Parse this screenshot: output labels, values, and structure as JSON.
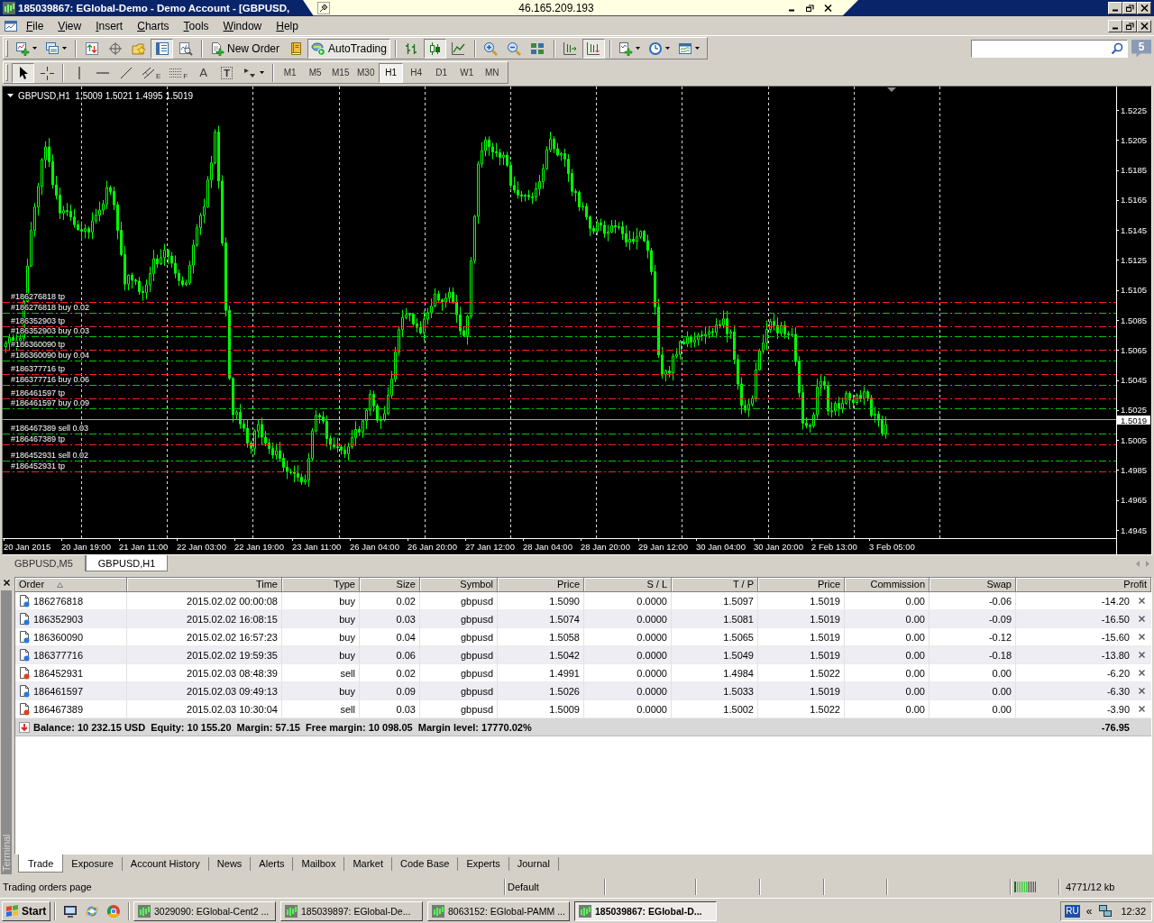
{
  "window": {
    "title": "185039867: EGlobal-Demo - Demo Account - [GBPUSD,"
  },
  "remote_bar": {
    "address": "46.165.209.193"
  },
  "menu": [
    "File",
    "View",
    "Insert",
    "Charts",
    "Tools",
    "Window",
    "Help"
  ],
  "toolbar": {
    "groups": [
      [
        {
          "kind": "new-chart",
          "pressed": false
        },
        {
          "kind": "profiles",
          "pressed": false
        }
      ],
      [
        {
          "kind": "market-watch",
          "pressed": false
        },
        {
          "kind": "data-window",
          "pressed": false
        },
        {
          "kind": "navigator",
          "pressed": false
        },
        {
          "kind": "terminal",
          "pressed": true
        },
        {
          "kind": "tester",
          "pressed": false
        }
      ],
      [
        {
          "kind": "new-order",
          "label": "New Order",
          "pressed": false
        },
        {
          "kind": "editor",
          "pressed": false
        },
        {
          "kind": "autotrading",
          "label": "AutoTrading",
          "pressed": true
        }
      ],
      [
        {
          "kind": "bar-chart",
          "pressed": false
        },
        {
          "kind": "candles",
          "pressed": true
        },
        {
          "kind": "line-chart",
          "pressed": false
        }
      ],
      [
        {
          "kind": "zoom-in",
          "pressed": false
        },
        {
          "kind": "zoom-out",
          "pressed": false
        },
        {
          "kind": "tile",
          "pressed": false
        }
      ],
      [
        {
          "kind": "chart-shift",
          "pressed": false
        },
        {
          "kind": "auto-scroll",
          "pressed": true
        }
      ],
      [
        {
          "kind": "indicators",
          "pressed": false
        },
        {
          "kind": "periods",
          "pressed": false
        },
        {
          "kind": "templates",
          "pressed": false
        }
      ]
    ]
  },
  "notifications": {
    "count": "5"
  },
  "drawing_tools": {
    "groups": [
      [
        {
          "kind": "cursor",
          "pressed": true
        },
        {
          "kind": "crosshair",
          "pressed": false
        }
      ],
      [
        {
          "kind": "vline",
          "pressed": false
        },
        {
          "kind": "hline",
          "pressed": false
        },
        {
          "kind": "trendline",
          "pressed": false
        },
        {
          "kind": "channel",
          "glyph": "E",
          "pressed": false
        },
        {
          "kind": "fibo",
          "glyph": "F",
          "pressed": false
        },
        {
          "kind": "text",
          "glyph": "A",
          "pressed": false
        },
        {
          "kind": "label",
          "glyph": "T",
          "pressed": false
        },
        {
          "kind": "arrows",
          "pressed": false
        }
      ]
    ]
  },
  "timeframes": [
    {
      "label": "M1",
      "selected": false
    },
    {
      "label": "M5",
      "selected": false
    },
    {
      "label": "M15",
      "selected": false
    },
    {
      "label": "M30",
      "selected": false
    },
    {
      "label": "H1",
      "selected": true
    },
    {
      "label": "H4",
      "selected": false
    },
    {
      "label": "D1",
      "selected": false
    },
    {
      "label": "W1",
      "selected": false
    },
    {
      "label": "MN",
      "selected": false
    }
  ],
  "chart": {
    "header": "GBPUSD,H1  1.5009 1.5021 1.4995 1.5019",
    "price_labels": [
      "1.5225",
      "1.5205",
      "1.5185",
      "1.5165",
      "1.5145",
      "1.5125",
      "1.5105",
      "1.5085",
      "1.5065",
      "1.5045",
      "1.5025",
      "1.5005",
      "1.4985",
      "1.4965",
      "1.4945"
    ],
    "current_price": "1.5019",
    "time_labels": [
      "20 Jan 2015",
      "20 Jan 19:00",
      "21 Jan 11:00",
      "22 Jan 03:00",
      "22 Jan 19:00",
      "23 Jan 11:00",
      "26 Jan 04:00",
      "26 Jan 20:00",
      "27 Jan 12:00",
      "28 Jan 04:00",
      "28 Jan 20:00",
      "29 Jan 12:00",
      "30 Jan 04:00",
      "30 Jan 20:00",
      "2 Feb 13:00",
      "3 Feb 05:00"
    ],
    "orders": [
      {
        "tp_label": "#186276818 tp",
        "entry_label": "#186276818 buy 0.02"
      },
      {
        "tp_label": "#186352903 tp",
        "entry_label": "#186352903 buy 0.03"
      },
      {
        "tp_label": "#186360090 tp",
        "entry_label": "#186360090 buy 0.04"
      },
      {
        "tp_label": "#186377716 tp",
        "entry_label": "#186377716 buy 0.06"
      },
      {
        "tp_label": "#186461597 tp",
        "entry_label": "#186461597 buy 0.09"
      },
      {
        "entry_label": "#186467389 sell 0.03",
        "tp_label": "#186467389 tp"
      },
      {
        "entry_label": "#186452931 sell 0.02",
        "tp_label": "#186452931 tp"
      }
    ]
  },
  "chart_tabs": [
    {
      "label": "GBPUSD,M5",
      "selected": false
    },
    {
      "label": "GBPUSD,H1",
      "selected": true
    }
  ],
  "terminal": {
    "title": "Terminal",
    "columns": [
      {
        "label": "Order",
        "sorted": true
      },
      {
        "label": "Time",
        "sorted": false
      },
      {
        "label": "Type",
        "sorted": false
      },
      {
        "label": "Size",
        "sorted": false
      },
      {
        "label": "Symbol",
        "sorted": false
      },
      {
        "label": "Price",
        "sorted": false
      },
      {
        "label": "S / L",
        "sorted": false
      },
      {
        "label": "T / P",
        "sorted": false
      },
      {
        "label": "Price",
        "sorted": false
      },
      {
        "label": "Commission",
        "sorted": false
      },
      {
        "label": "Swap",
        "sorted": false
      },
      {
        "label": "Profit",
        "sorted": false
      }
    ],
    "rows": [
      {
        "kind": "buy",
        "cells": [
          "186276818",
          "2015.02.02 00:00:08",
          "buy",
          "0.02",
          "gbpusd",
          "1.5090",
          "0.0000",
          "1.5097",
          "1.5019",
          "0.00",
          "-0.06",
          "-14.20"
        ]
      },
      {
        "kind": "buy",
        "cells": [
          "186352903",
          "2015.02.02 16:08:15",
          "buy",
          "0.03",
          "gbpusd",
          "1.5074",
          "0.0000",
          "1.5081",
          "1.5019",
          "0.00",
          "-0.09",
          "-16.50"
        ]
      },
      {
        "kind": "buy",
        "cells": [
          "186360090",
          "2015.02.02 16:57:23",
          "buy",
          "0.04",
          "gbpusd",
          "1.5058",
          "0.0000",
          "1.5065",
          "1.5019",
          "0.00",
          "-0.12",
          "-15.60"
        ]
      },
      {
        "kind": "buy",
        "cells": [
          "186377716",
          "2015.02.02 19:59:35",
          "buy",
          "0.06",
          "gbpusd",
          "1.5042",
          "0.0000",
          "1.5049",
          "1.5019",
          "0.00",
          "-0.18",
          "-13.80"
        ]
      },
      {
        "kind": "sell",
        "cells": [
          "186452931",
          "2015.02.03 08:48:39",
          "sell",
          "0.02",
          "gbpusd",
          "1.4991",
          "0.0000",
          "1.4984",
          "1.5022",
          "0.00",
          "0.00",
          "-6.20"
        ]
      },
      {
        "kind": "buy",
        "cells": [
          "186461597",
          "2015.02.03 09:49:13",
          "buy",
          "0.09",
          "gbpusd",
          "1.5026",
          "0.0000",
          "1.5033",
          "1.5019",
          "0.00",
          "0.00",
          "-6.30"
        ]
      },
      {
        "kind": "sell",
        "cells": [
          "186467389",
          "2015.02.03 10:30:04",
          "sell",
          "0.03",
          "gbpusd",
          "1.5009",
          "0.0000",
          "1.5002",
          "1.5022",
          "0.00",
          "0.00",
          "-3.90"
        ]
      }
    ],
    "summary": {
      "text": "Balance: 10 232.15 USD  Equity: 10 155.20  Margin: 57.15  Free margin: 10 098.05  Margin level: 17770.02%",
      "profit": "-76.95"
    },
    "tabs": [
      {
        "label": "Trade",
        "selected": true
      },
      {
        "label": "Exposure",
        "selected": false
      },
      {
        "label": "Account History",
        "selected": false
      },
      {
        "label": "News",
        "selected": false
      },
      {
        "label": "Alerts",
        "selected": false
      },
      {
        "label": "Mailbox",
        "selected": false
      },
      {
        "label": "Market",
        "selected": false
      },
      {
        "label": "Code Base",
        "selected": false
      },
      {
        "label": "Experts",
        "selected": false
      },
      {
        "label": "Journal",
        "selected": false
      }
    ]
  },
  "status_bar": {
    "message": "Trading orders page",
    "profile": "Default",
    "traffic": "4771/12 kb"
  },
  "taskbar": {
    "start": "Start",
    "tasks": [
      {
        "label": "3029090: EGlobal-Cent2 ...",
        "selected": false
      },
      {
        "label": "185039897: EGlobal-De...",
        "selected": false
      },
      {
        "label": "8063152: EGlobal-PAMM ...",
        "selected": false
      },
      {
        "label": "185039867: EGlobal-D...",
        "selected": true
      }
    ],
    "language": "RU",
    "tray_toggle": "«",
    "clock": "12:32"
  }
}
